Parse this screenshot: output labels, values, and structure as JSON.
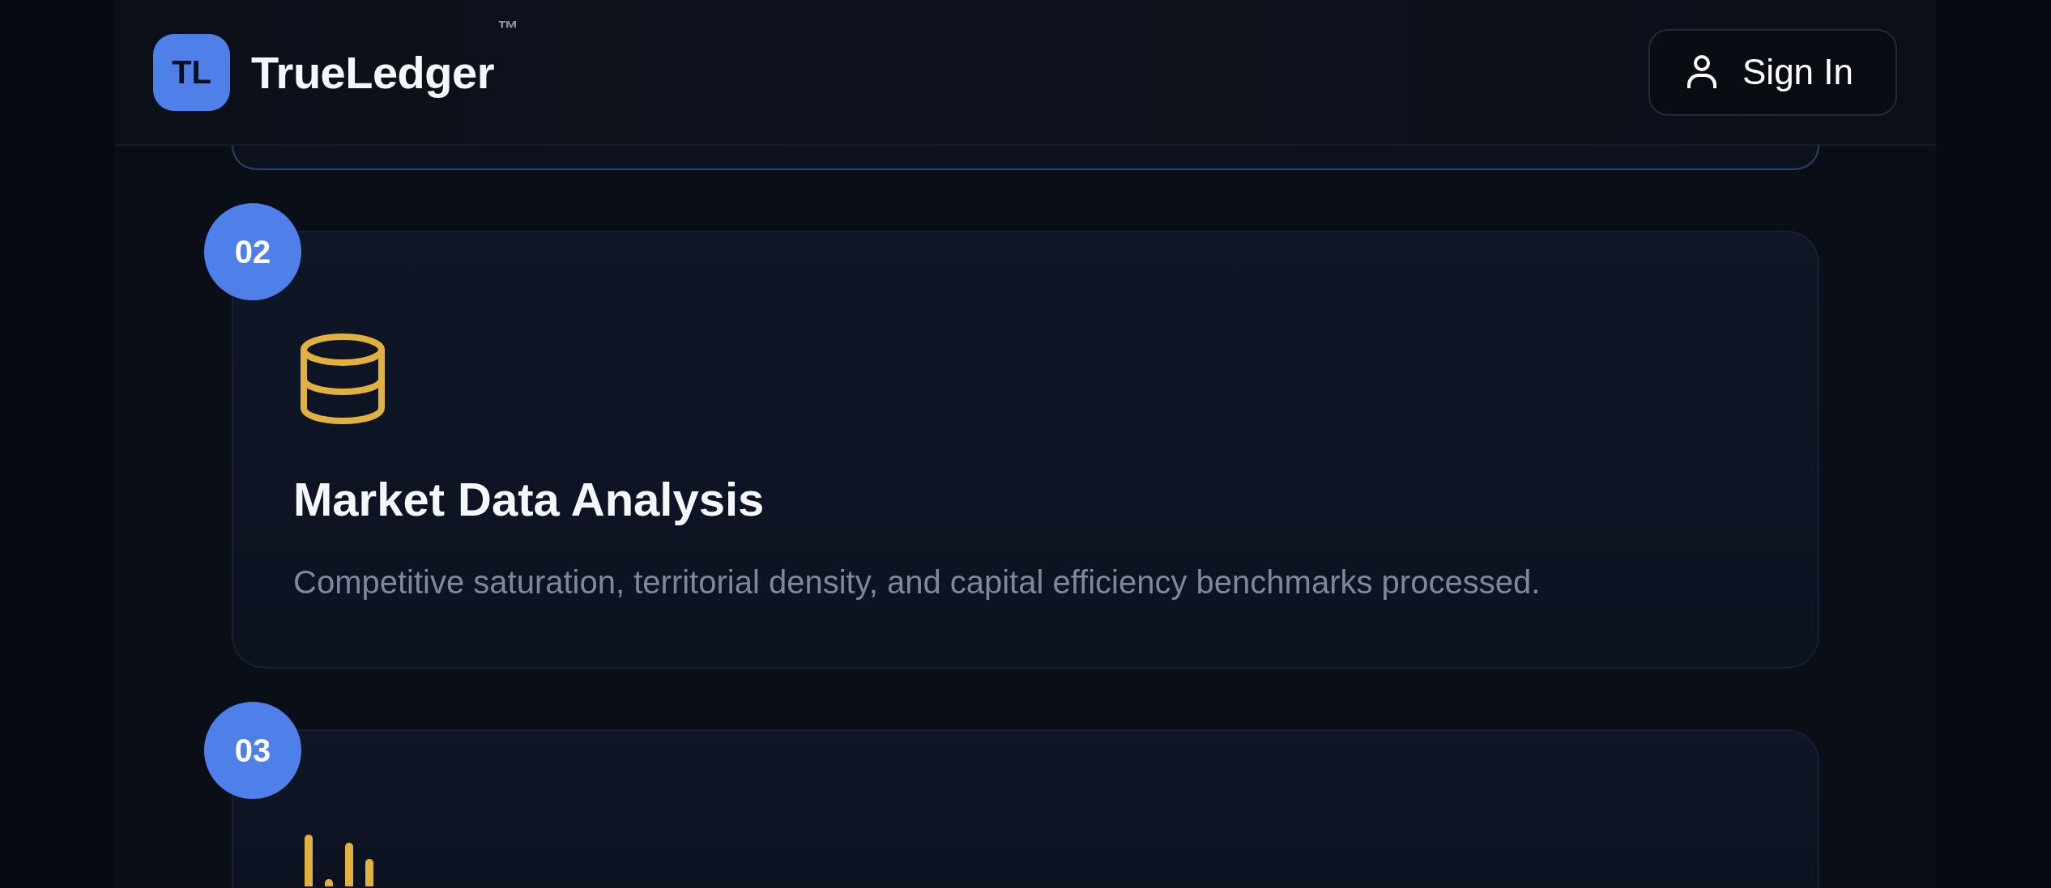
{
  "header": {
    "logo": {
      "initials": "TL"
    },
    "brand": "TrueLedger",
    "trademark": "™",
    "sign_in_button": {
      "label": "Sign In"
    }
  },
  "steps": [
    {
      "number": "02",
      "icon": {
        "kind": "database"
      },
      "title": "Market Data Analysis",
      "description": "Competitive saturation, territorial density, and capital efficiency benchmarks processed."
    },
    {
      "number": "03",
      "icon": {
        "kind": "bar-chart"
      }
    }
  ]
}
